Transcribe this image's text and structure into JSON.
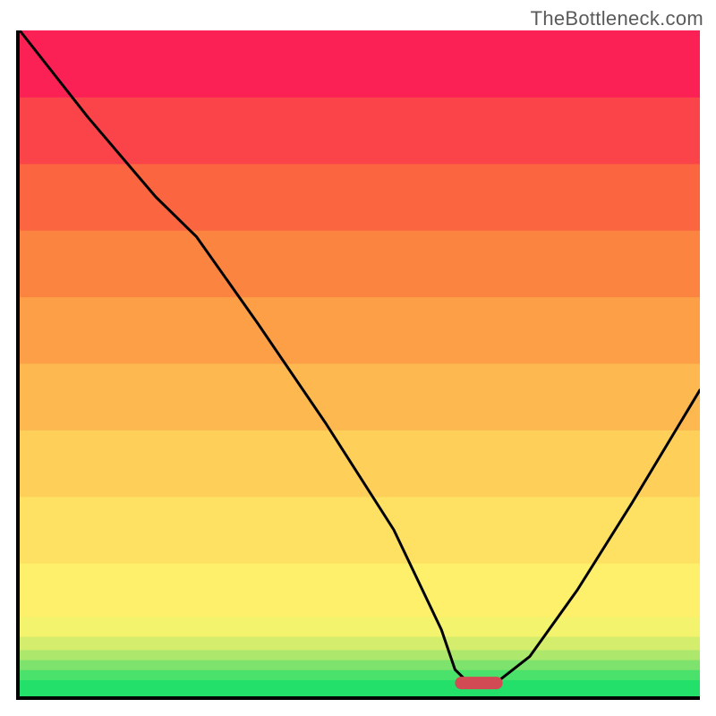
{
  "watermark": "TheBottleneck.com",
  "chart_data": {
    "type": "line",
    "title": "",
    "xlabel": "",
    "ylabel": "",
    "xlim": [
      0,
      100
    ],
    "ylim": [
      0,
      100
    ],
    "series": [
      {
        "name": "bottleneck-curve",
        "x": [
          0,
          10,
          20,
          26,
          35,
          45,
          55,
          62,
          64,
          66,
          70,
          75,
          82,
          90,
          100
        ],
        "y": [
          100,
          87,
          75,
          69,
          56,
          41,
          25,
          10,
          4,
          2,
          2,
          6,
          16,
          29,
          46
        ]
      }
    ],
    "marker": {
      "x_start": 64,
      "x_end": 71,
      "y": 2
    },
    "background_bands": [
      {
        "y_from": 0.0,
        "y_to": 2.5,
        "color": "#22e06a"
      },
      {
        "y_from": 2.5,
        "y_to": 4.0,
        "color": "#4be26b"
      },
      {
        "y_from": 4.0,
        "y_to": 5.5,
        "color": "#7ee36c"
      },
      {
        "y_from": 5.5,
        "y_to": 7.0,
        "color": "#ade76b"
      },
      {
        "y_from": 7.0,
        "y_to": 9.0,
        "color": "#d4ed6c"
      },
      {
        "y_from": 9.0,
        "y_to": 12.0,
        "color": "#f3f36d"
      },
      {
        "y_from": 12.0,
        "y_to": 20.0,
        "color": "#fff06c"
      },
      {
        "y_from": 20.0,
        "y_to": 30.0,
        "color": "#fee163"
      },
      {
        "y_from": 30.0,
        "y_to": 40.0,
        "color": "#fecf59"
      },
      {
        "y_from": 40.0,
        "y_to": 50.0,
        "color": "#fdb84f"
      },
      {
        "y_from": 50.0,
        "y_to": 60.0,
        "color": "#fc9f47"
      },
      {
        "y_from": 60.0,
        "y_to": 70.0,
        "color": "#fb8440"
      },
      {
        "y_from": 70.0,
        "y_to": 80.0,
        "color": "#fb6540"
      },
      {
        "y_from": 80.0,
        "y_to": 90.0,
        "color": "#fb434a"
      },
      {
        "y_from": 90.0,
        "y_to": 100.0,
        "color": "#fc2155"
      }
    ],
    "curve_color": "#000000",
    "marker_color": "#d24b54"
  }
}
